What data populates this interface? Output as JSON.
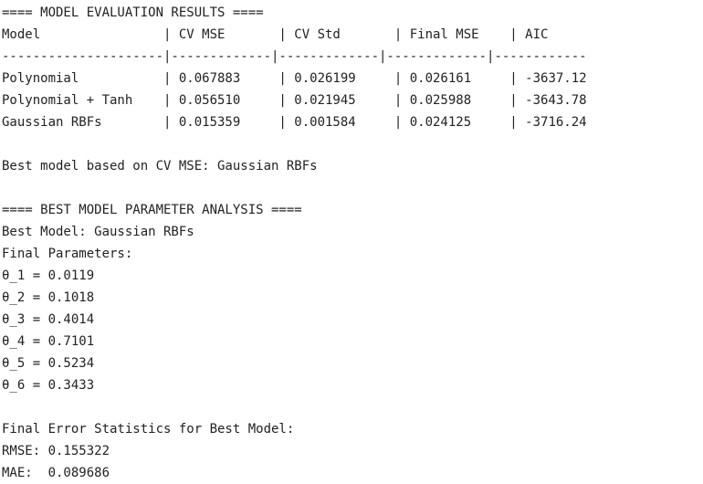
{
  "evaluation": {
    "header": "==== MODEL EVALUATION RESULTS ====",
    "table_header": "Model                | CV MSE       | CV Std       | Final MSE    | AIC",
    "separator": "---------------------|-------------|-------------|-------------|------------",
    "rows": [
      "Polynomial           | 0.067883     | 0.026199     | 0.026161     | -3637.12",
      "Polynomial + Tanh    | 0.056510     | 0.021945     | 0.025988     | -3643.78",
      "Gaussian RBFs        | 0.015359     | 0.001584     | 0.024125     | -3716.24"
    ],
    "best_model_line": "Best model based on CV MSE: Gaussian RBFs"
  },
  "analysis": {
    "header": "==== BEST MODEL PARAMETER ANALYSIS ====",
    "best_model": "Best Model: Gaussian RBFs",
    "params_label": "Final Parameters:",
    "params": [
      "θ_1 = 0.0119",
      "θ_2 = 0.1018",
      "θ_3 = 0.4014",
      "θ_4 = 0.7101",
      "θ_5 = 0.5234",
      "θ_6 = 0.3433"
    ]
  },
  "error_stats": {
    "header": "Final Error Statistics for Best Model:",
    "rmse": "RMSE: 0.155322",
    "mae": "MAE:  0.089686"
  }
}
